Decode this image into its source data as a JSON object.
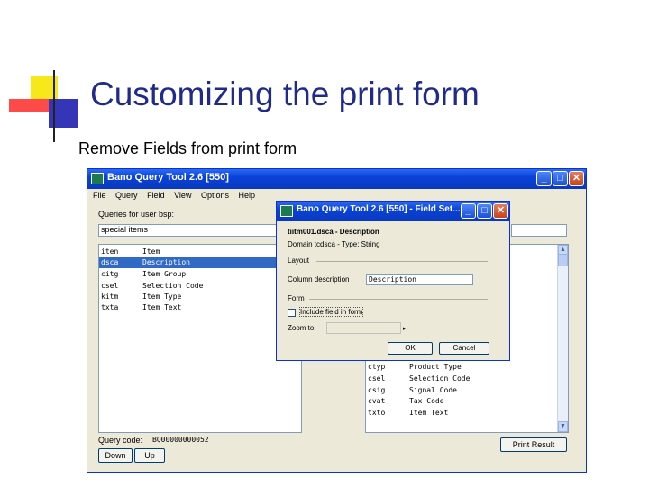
{
  "slide": {
    "title": "Customizing the print form",
    "subtitle": "Remove Fields from print form"
  },
  "main_window": {
    "title": "Bano Query Tool 2.6 [550]",
    "menu": [
      "File",
      "Query",
      "Field",
      "View",
      "Options",
      "Help"
    ],
    "queries_label": "Queries for user bsp:",
    "query_name": "special items",
    "left_fields": [
      {
        "code": "iten",
        "name": "Item"
      },
      {
        "code": "dsca",
        "name": "Description",
        "selected": true
      },
      {
        "code": "citg",
        "name": "Item Group"
      },
      {
        "code": "csel",
        "name": "Selection Code"
      },
      {
        "code": "kitm",
        "name": "Item Type"
      },
      {
        "code": "txta",
        "name": "Item Text"
      }
    ],
    "right_fields": [
      {
        "code": "ctyp",
        "name": "Product Type"
      },
      {
        "code": "csel",
        "name": "Selection Code"
      },
      {
        "code": "csig",
        "name": "Signal Code"
      },
      {
        "code": "cvat",
        "name": "Tax Code"
      },
      {
        "code": "txto",
        "name": "Item Text"
      }
    ],
    "query_code_label": "Query code:",
    "query_code_value": "BQ00000000052",
    "down_label": "Down",
    "up_label": "Up",
    "print_result_label": "Print Result"
  },
  "dialog": {
    "title": "Bano Query Tool 2.6 [550] - Field Set...",
    "header": "tiitm001.dsca - Description",
    "domain": "Domain tcdsca - Type: String",
    "layout_group": "Layout",
    "column_desc_label": "Column description",
    "column_desc_value": "Description",
    "form_group": "Form",
    "include_label": "Include field in form",
    "include_checked": false,
    "zoomto_label": "Zoom to",
    "zoomto_value": "",
    "ok_label": "OK",
    "cancel_label": "Cancel"
  },
  "colors": {
    "title_text": "#1f2a8a",
    "titlebar": "#0a42d8",
    "selection": "#316ac5",
    "window_bg": "#ece9d8"
  }
}
